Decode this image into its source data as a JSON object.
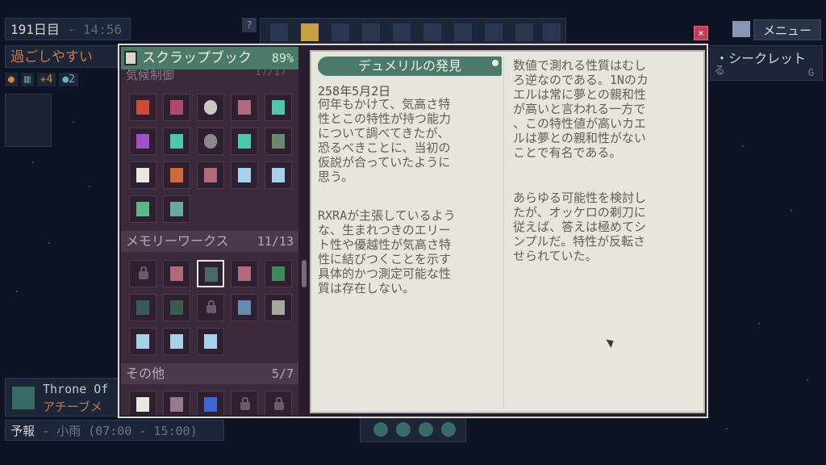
{
  "hud": {
    "day": "191日目",
    "time": "- 14:56",
    "status": "過ごしやすい",
    "stats": [
      "●",
      "▥",
      "✳4",
      "●2"
    ],
    "help": "?",
    "menu": "メニュー",
    "secret": "・シークレット",
    "secret_sub": "る",
    "secret_key": "G",
    "throne_title": "Throne Of",
    "throne_sub": "アチーブメ",
    "forecast_label": "予報",
    "forecast_weather": "- 小雨 (07:00 - 15:00)",
    "close": "×"
  },
  "scrapbook": {
    "title": "スクラップブック",
    "percent": "89%",
    "cut_section": "気候制御",
    "cut_count": "17/17",
    "sections": [
      {
        "name": "メモリーワークス",
        "count": "11/13"
      },
      {
        "name": "その他",
        "count": "5/7"
      }
    ]
  },
  "book": {
    "title": "デュメリルの発見",
    "date": "258年5月2日",
    "p1": "何年もかけて、気高さ特\n性とこの特性が持つ能力\nについて調べてきたが、\n恐るべきことに、当初の\n仮説が合っていたように\n思う。",
    "p2": "RXRAが主張しているよう\nな、生まれつきのエリー\nト性や優越性が気高さ特\n性に結びつくことを示す\n具体的かつ測定可能な性\n質は存在しない。",
    "p3": "数値で測れる性質はむし\nろ逆なのである。1Nのカ\nエルは常に夢との親和性\nが高いと言われる一方で\n、この特性値が高いカエ\nルは夢との親和性がない\nことで有名である。",
    "p4": "あらゆる可能性を検討し\nたが、オッケロの剃刀に\n従えば、答えは極めてシ\nンプルだ。特性が反転さ\nせられていた。"
  },
  "colors": {
    "accent": "#4a7a6a",
    "paper": "#e6e6de",
    "panel": "#3a2a3a",
    "bg": "#0f1424"
  }
}
